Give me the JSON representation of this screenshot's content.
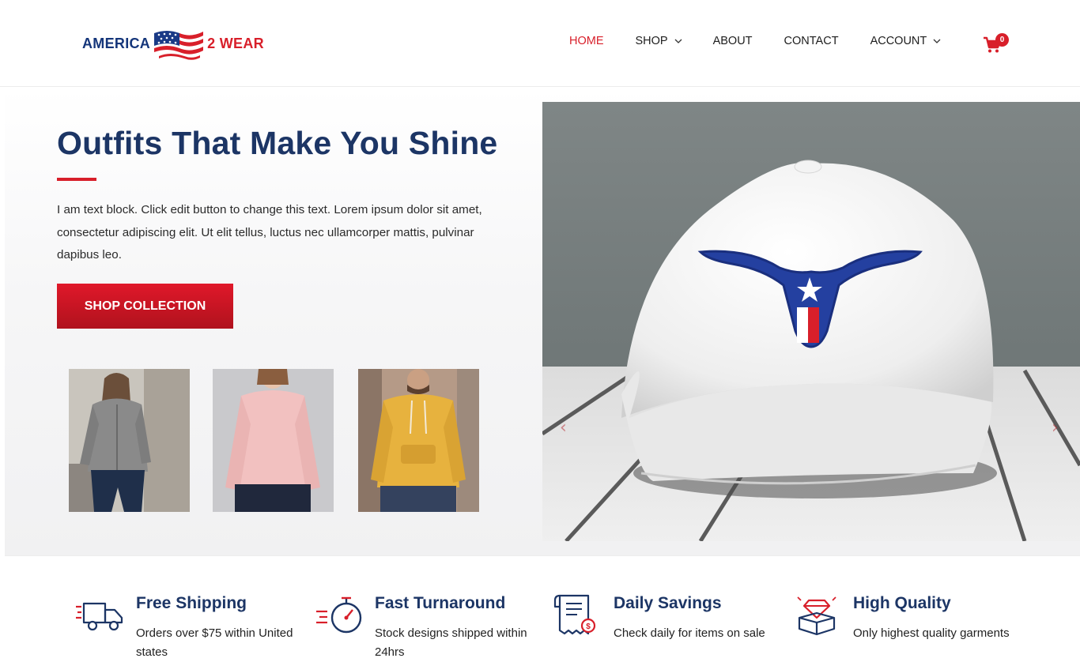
{
  "brand": {
    "part1": "AMERICA",
    "part2": "2 WEAR"
  },
  "nav": {
    "items": [
      {
        "label": "HOME",
        "active": true,
        "dropdown": false
      },
      {
        "label": "SHOP",
        "active": false,
        "dropdown": true
      },
      {
        "label": "ABOUT",
        "active": false,
        "dropdown": false
      },
      {
        "label": "CONTACT",
        "active": false,
        "dropdown": false
      },
      {
        "label": "ACCOUNT",
        "active": false,
        "dropdown": true
      }
    ],
    "cart_count": "0"
  },
  "hero": {
    "title": "Outfits That Make You Shine",
    "text": "I am text block. Click edit button to change this text. Lorem ipsum dolor sit amet, consectetur adipiscing elit. Ut elit tellus, luctus nec ullamcorper mattis, pulvinar dapibus leo.",
    "cta_label": "SHOP COLLECTION"
  },
  "thumbnails": [
    {
      "name": "gray-zip-hoodie",
      "color": "#8a8a8a"
    },
    {
      "name": "pink-sweatshirt",
      "color": "#f2c1c0"
    },
    {
      "name": "yellow-hoodie",
      "color": "#e7b23e"
    }
  ],
  "slider": {
    "prev_icon": "chevron-left-icon",
    "next_icon": "chevron-right-icon"
  },
  "features": [
    {
      "title": "Free Shipping",
      "text": "Orders over $75 within United states",
      "icon": "truck-icon"
    },
    {
      "title": "Fast Turnaround",
      "text": "Stock designs shipped within 24hrs",
      "icon": "stopwatch-icon"
    },
    {
      "title": "Daily Savings",
      "text": "Check daily for items on sale",
      "icon": "receipt-icon"
    },
    {
      "title": "High Quality",
      "text": "Only highest quality garments",
      "icon": "diamond-box-icon"
    }
  ],
  "colors": {
    "navy": "#1c3565",
    "red": "#d81f2a"
  }
}
